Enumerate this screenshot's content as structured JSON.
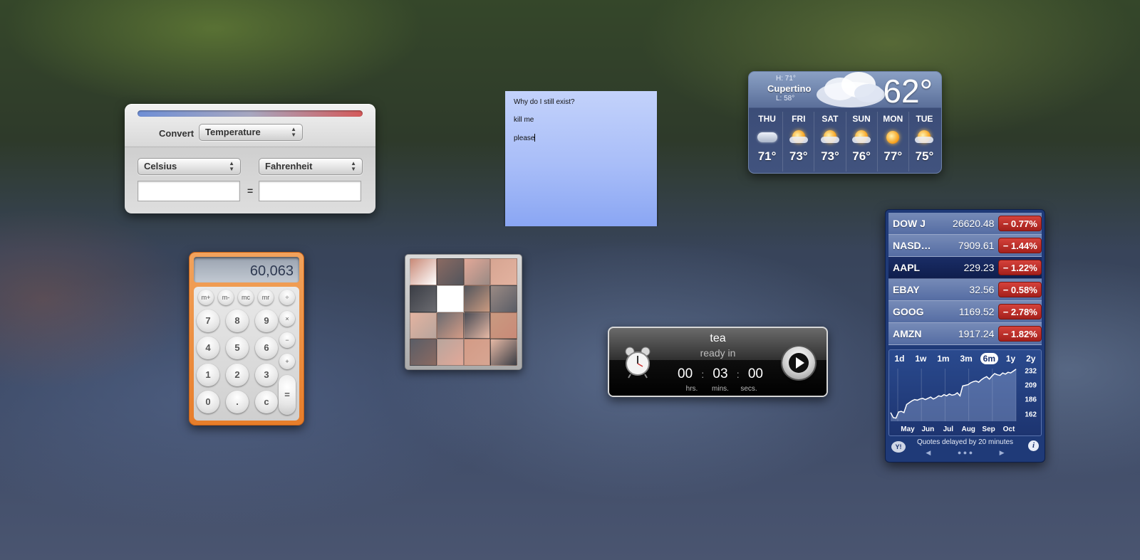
{
  "converter": {
    "convert_label": "Convert",
    "category": "Temperature",
    "from_unit": "Celsius",
    "to_unit": "Fahrenheit",
    "from_value": "",
    "to_value": "",
    "equals": "="
  },
  "sticky": {
    "lines": [
      "Why do I still exist?",
      "kill me",
      "please"
    ],
    "color": "#a8bdf8"
  },
  "weather": {
    "city": "Cupertino",
    "high": "H: 71°",
    "low": "L: 58°",
    "current_temp": "62°",
    "current_condition_icon": "cloud-icon",
    "forecast": [
      {
        "day": "THU",
        "temp": "71°",
        "icon": "cloudy-icon"
      },
      {
        "day": "FRI",
        "temp": "73°",
        "icon": "partly-sunny-icon"
      },
      {
        "day": "SAT",
        "temp": "73°",
        "icon": "partly-sunny-icon"
      },
      {
        "day": "SUN",
        "temp": "76°",
        "icon": "partly-sunny-icon"
      },
      {
        "day": "MON",
        "temp": "77°",
        "icon": "sun-icon"
      },
      {
        "day": "TUE",
        "temp": "75°",
        "icon": "partly-sunny-icon"
      }
    ]
  },
  "calculator": {
    "display": "60,063",
    "memory_keys": [
      "m+",
      "m-",
      "mc",
      "mr"
    ],
    "keys": {
      "divide": "÷",
      "multiply": "×",
      "minus": "−",
      "plus": "+",
      "equals": "=",
      "seven": "7",
      "eight": "8",
      "nine": "9",
      "four": "4",
      "five": "5",
      "six": "6",
      "one": "1",
      "two": "2",
      "three": "3",
      "zero": "0",
      "decimal": ".",
      "clear": "c"
    },
    "accent_color": "#e77d2a"
  },
  "tile_game": {
    "blank_index": 5
  },
  "timer": {
    "name": "tea",
    "subtitle": "ready in",
    "hours": "00",
    "minutes": "03",
    "seconds": "00",
    "hours_label": "hrs.",
    "minutes_label": "mins.",
    "seconds_label": "secs.",
    "separator": ":"
  },
  "stocks": {
    "quotes": [
      {
        "symbol": "DOW J",
        "price": "26620.48",
        "change": "− 0.77%"
      },
      {
        "symbol": "NASD…",
        "price": "7909.61",
        "change": "− 1.44%"
      },
      {
        "symbol": "AAPL",
        "price": "229.23",
        "change": "− 1.22%"
      },
      {
        "symbol": "EBAY",
        "price": "32.56",
        "change": "− 0.58%"
      },
      {
        "symbol": "GOOG",
        "price": "1169.52",
        "change": "− 2.78%"
      },
      {
        "symbol": "AMZN",
        "price": "1917.24",
        "change": "− 1.82%"
      }
    ],
    "selected_symbol": "AAPL",
    "ranges": [
      "1d",
      "1w",
      "1m",
      "3m",
      "6m",
      "1y",
      "2y"
    ],
    "active_range": "6m",
    "footer_text": "Quotes delayed by 20 minutes",
    "yahoo_label": "Y!",
    "info_label": "i",
    "nav_prev": "◀",
    "nav_dots": "● ● ●",
    "nav_next": "▶",
    "negative_color": "#c0302a"
  },
  "chart_data": {
    "type": "line",
    "x_tick_labels": [
      "May",
      "Jun",
      "Jul",
      "Aug",
      "Sep",
      "Oct"
    ],
    "y_tick_labels": [
      "232",
      "209",
      "186",
      "162"
    ],
    "ylim": [
      150,
      235
    ],
    "series": [
      {
        "values": [
          164,
          156,
          155,
          165,
          166,
          164,
          177,
          180,
          183,
          185,
          184,
          186,
          187,
          185,
          187,
          189,
          186,
          188,
          191,
          190,
          193,
          191,
          194,
          192,
          193,
          196,
          191,
          207,
          208,
          209,
          212,
          214,
          215,
          213,
          217,
          220,
          222,
          218,
          223,
          227,
          225,
          224,
          228,
          226,
          229,
          228,
          231,
          234
        ]
      }
    ]
  }
}
